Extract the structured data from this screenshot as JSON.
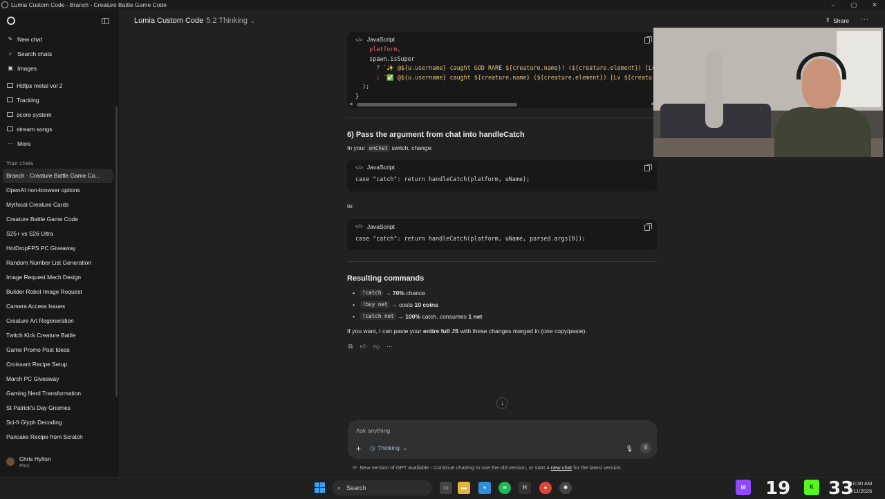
{
  "window": {
    "title": "Lumia Custom Code - Branch - Creature Battle Game Code",
    "controls": [
      "–",
      "▢",
      "✕"
    ]
  },
  "sidebar": {
    "nav": [
      {
        "label": "New chat",
        "icon": "pencil-icon"
      },
      {
        "label": "Search chats",
        "icon": "search-icon"
      },
      {
        "label": "Images",
        "icon": "image-icon"
      }
    ],
    "projects": [
      {
        "label": "Hdfps metal vol 2",
        "icon": "folder-icon"
      },
      {
        "label": "Tracking",
        "icon": "folder-icon"
      },
      {
        "label": "score system",
        "icon": "folder-icon"
      },
      {
        "label": "stream songs",
        "icon": "folder-icon"
      },
      {
        "label": "More",
        "icon": "more-icon"
      }
    ],
    "chats_label": "Your chats",
    "chats": [
      "Branch · Creature Battle Game Co...",
      "OpenAI non-browser options",
      "Mythical Creature Cards",
      "Creature Battle Game Code",
      "S25+ vs S26 Ultra",
      "HotDropFPS PC Giveaway",
      "Random Number List Generation",
      "Image Request Mech Design",
      "Builder Robot Image Request",
      "Camera Access Issues",
      "Creature Art Regeneration",
      "Twitch Kick Creature Battle",
      "Game Promo Post Ideas",
      "Croissant Recipe Setup",
      "March PC Giveaway",
      "Gaming Nerd Transformation",
      "St Patrick's Day Gnomes",
      "Sci-fi Glyph Decoding",
      "Pancake Recipe from Scratch"
    ],
    "user": {
      "name": "Chris Hylton",
      "plan": "Plus"
    }
  },
  "header": {
    "title": "Lumia Custom Code",
    "model": "5.2 Thinking",
    "share_label": "Share",
    "more": "···"
  },
  "main": {
    "block1": {
      "lang": "JavaScript",
      "lines": [
        "    platform,",
        "    spawn.isSuper",
        "      ? `✨ @${u.username} caught GOD RARE ${creature.name}! (${creature.element}) [Lv",
        "      : `✅ @${u.username} caught ${creature.name} (${creature.element}) [Lv ${creatu",
        "  );",
        "}"
      ]
    },
    "step6_heading": "6) Pass the argument from chat into handleCatch",
    "step6_intro_pre": "In your ",
    "step6_intro_code": "onChat",
    "step6_intro_post": " switch, change:",
    "block2": {
      "lang": "JavaScript",
      "code": "case \"catch\": return handleCatch(platform, uName);"
    },
    "to_label": "to:",
    "block3": {
      "lang": "JavaScript",
      "code": "case \"catch\": return handleCatch(platform, uName, parsed.args[0]);"
    },
    "results_heading": "Resulting commands",
    "commands": [
      {
        "code": "!catch",
        "arrow": " → ",
        "bold": "70%",
        "rest": " chance"
      },
      {
        "code": "!buy net",
        "arrow": " → costs ",
        "bold": "10 coins",
        "rest": ""
      },
      {
        "code": "!catch net",
        "arrow": " → ",
        "bold": "100%",
        "rest": " catch, consumes ",
        "bold2": "1 net"
      }
    ],
    "closing_pre": "If you want, I can paste your ",
    "closing_bold": "entire full JS",
    "closing_post": " with these changes merged in (one copy/paste)."
  },
  "composer": {
    "placeholder": "Ask anything",
    "mode": "Thinking",
    "notice_pre": "New version of GPT available - Continue chatting to use the old version, or start a ",
    "notice_link": "new chat",
    "notice_post": " for the latest version."
  },
  "taskbar": {
    "search_label": "Search",
    "viewers_twitch": "19",
    "viewers_kick": "33",
    "time": "10:30 AM",
    "date": "3/11/2026"
  },
  "colors": {
    "twitch": "#9146ff",
    "kick": "#53fc18",
    "accent": "#3aa0f0"
  }
}
